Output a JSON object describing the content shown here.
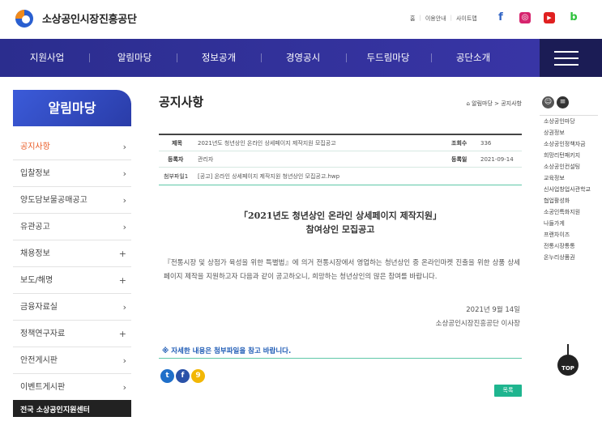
{
  "header": {
    "org_name": "소상공인시장진흥공단",
    "utils": [
      "홈",
      "이용안내",
      "사이트맵"
    ],
    "sns": [
      {
        "icon": "facebook-icon",
        "glyph": "f",
        "color": "#2f63c4"
      },
      {
        "icon": "instagram-icon",
        "glyph": "◎",
        "color": "#d6246e"
      },
      {
        "icon": "youtube-icon",
        "glyph": "▶",
        "color": "#e02020"
      },
      {
        "icon": "blog-icon",
        "glyph": "b",
        "color": "#2ec23c"
      }
    ]
  },
  "nav": {
    "items": [
      "지원사업",
      "알림마당",
      "정보공개",
      "경영공시",
      "두드림마당",
      "공단소개"
    ]
  },
  "sidebar": {
    "title": "알림마당",
    "items": [
      {
        "label": "공지사항",
        "icon": "›",
        "active": true
      },
      {
        "label": "입찰정보",
        "icon": "›"
      },
      {
        "label": "양도담보물공매공고",
        "icon": "›"
      },
      {
        "label": "유관공고",
        "icon": "›"
      },
      {
        "label": "채용정보",
        "icon": "+"
      },
      {
        "label": "보도/해명",
        "icon": "+"
      },
      {
        "label": "금융자료실",
        "icon": "›"
      },
      {
        "label": "정책연구자료",
        "icon": "+"
      },
      {
        "label": "안전게시판",
        "icon": "›"
      },
      {
        "label": "이벤트게시판",
        "icon": "›"
      }
    ],
    "footer": "전국 소상공인지원센터"
  },
  "main": {
    "page_title": "공지사항",
    "breadcrumb": "알림마당 > 공지사항",
    "post": {
      "subject_label": "제목",
      "subject": "2021년도 청년상인 온라인 상세페이지 제작지원 모집공고",
      "views_label": "조회수",
      "views": "336",
      "author_label": "등록자",
      "author": "관리자",
      "date_label": "등록일",
      "date": "2021-09-14",
      "attach_label": "첨부파일1",
      "attachment": "[공고] 온라인 상세페이지 제작지원 청년상인 모집공고.hwp"
    },
    "content_title_line1": "「2021년도 청년상인 온라인 상세페이지 제작지원」",
    "content_title_line2": "참여상인 모집공고",
    "body": "『전통시장 및 상점가 육성을 위한 특별법』에 의거 전통시장에서 영업하는 청년상인 중 온라인마켓 진출을 위한 상품 상세페이지 제작을 지원하고자 다음과 같이 공고하오니, 희망하는 청년상인의 많은 참여를 바랍니다.",
    "sign_date": "2021년 9월 14일",
    "signer": "소상공인시장진흥공단 이사장",
    "note": "※ 자세한 내용은 첨부파일을 참고 바랍니다.",
    "share_icons": [
      {
        "icon": "twitter-share-icon",
        "glyph": "t",
        "color": "#1f6fc9"
      },
      {
        "icon": "facebook-share-icon",
        "glyph": "f",
        "color": "#2a52a8"
      },
      {
        "icon": "kakao-share-icon",
        "glyph": "9",
        "color": "#f2b705"
      }
    ],
    "list_button": "목록"
  },
  "quick": {
    "items": [
      "소상공인마당",
      "상권정보",
      "소상공인정책자금",
      "희망리턴패키지",
      "소상공인컨설팅",
      "교육정보",
      "신사업창업사관학교",
      "협업활성화",
      "소공인특화지원",
      "나들가게",
      "프랜차이즈",
      "전통시장통통",
      "온누리상품권"
    ],
    "top_label": "TOP"
  }
}
